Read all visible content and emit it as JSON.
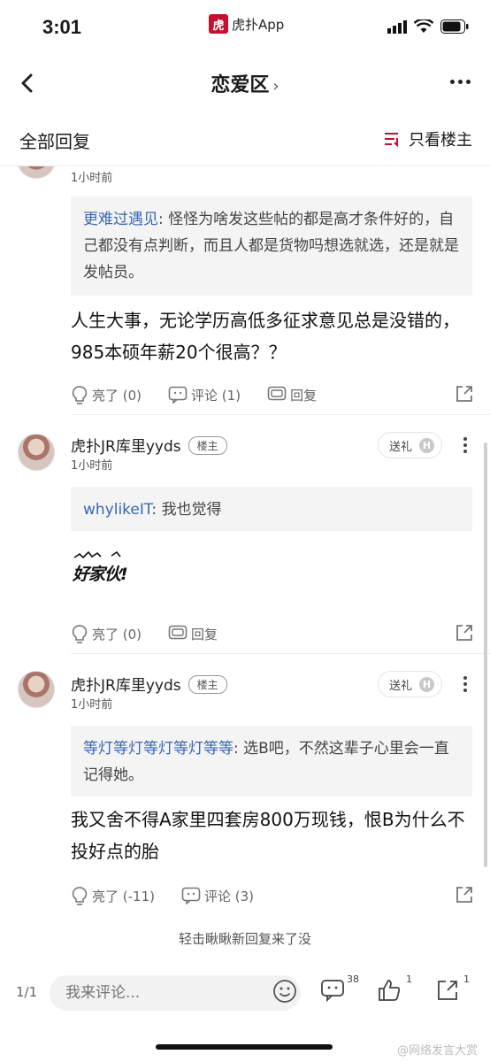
{
  "status_bar": {
    "time": "3:01",
    "app_logo_text": "虎",
    "app_name": "虎扑App"
  },
  "nav": {
    "title": "恋爱区",
    "title_chevron": "›"
  },
  "subbar": {
    "title": "全部回复",
    "filter_label": "只看楼主"
  },
  "posts": [
    {
      "time": "1小时前",
      "quote_author": "更难过遇见",
      "quote_text": "怪怪为啥发这些帖的都是高才条件好的，自己都没有点判断，而且人都是货物吗想选就选，还是就是发帖员。",
      "body": "人生大事，无论学历高低多征求意见总是没错的，985本硕年薪20个很高？？",
      "like_label": "亮了 (0)",
      "comment_label": "评论 (1)",
      "reply_label": "回复"
    },
    {
      "username": "虎扑JR库里yyds",
      "badge": "楼主",
      "time": "1小时前",
      "gift_label": "送礼",
      "gift_badge": "H",
      "quote_author": "whylikeIT",
      "quote_text": "我也觉得",
      "sticker_text": "好家伙!",
      "like_label": "亮了 (0)",
      "reply_label": "回复"
    },
    {
      "username": "虎扑JR库里yyds",
      "badge": "楼主",
      "time": "1小时前",
      "gift_label": "送礼",
      "gift_badge": "H",
      "quote_author": "等灯等灯等灯等灯等等",
      "quote_text": "选B吧，不然这辈子心里会一直记得她。",
      "body": "我又舍不得A家里四套房800万现钱，恨B为什么不投好点的胎",
      "like_label": "亮了 (-11)",
      "comment_label": "评论 (3)"
    }
  ],
  "load_more": "轻击瞅瞅新回复来了没",
  "bottom_bar": {
    "page": "1/1",
    "comment_placeholder": "我来评论...",
    "comments_count": "38",
    "likes_count": "1",
    "shares_count": "1"
  },
  "watermark": "@网络发言大赏",
  "colors": {
    "accent_blue": "#3a67b2",
    "brand_red": "#c8102e"
  }
}
